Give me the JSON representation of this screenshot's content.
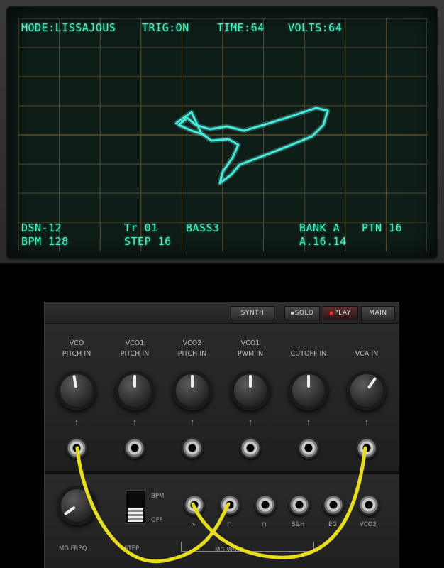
{
  "scope": {
    "mode": "MODE:LISSAJOUS",
    "trig": "TRIG:ON",
    "time": "TIME:64",
    "volts": "VOLTS:64",
    "device": "DSN-12",
    "bpm": "BPM 128",
    "track": "Tr 01",
    "step": "STEP 16",
    "patch": "BASS3",
    "bank": "BANK A",
    "pattern": "PTN 16",
    "position": "A.16.14",
    "trace_color": "#33e6d6",
    "grid_color": "#5a4e2a"
  },
  "toolbar": {
    "synth": "SYNTH",
    "solo": "SOLO",
    "play": "PLAY",
    "main": "MAIN"
  },
  "inputs": [
    {
      "line1": "VCO",
      "line2": "PITCH IN"
    },
    {
      "line1": "VCO1",
      "line2": "PITCH IN"
    },
    {
      "line1": "VCO2",
      "line2": "PITCH IN"
    },
    {
      "line1": "VCO1",
      "line2": "PWM IN"
    },
    {
      "line1": "",
      "line2": "CUTOFF IN"
    },
    {
      "line1": "",
      "line2": "VCA IN"
    }
  ],
  "lower": {
    "mg_freq": "MG FREQ",
    "range_label": "STEP",
    "bpm": "BPM",
    "off": "OFF",
    "wave_labels": [
      "∿",
      "⊓",
      "⊓",
      "S&H",
      "EG",
      "VCO2"
    ],
    "mg_wave": "MG WAVE"
  },
  "colors": {
    "cable": "#e8dc1e",
    "led_active": "#ff2a2a"
  }
}
